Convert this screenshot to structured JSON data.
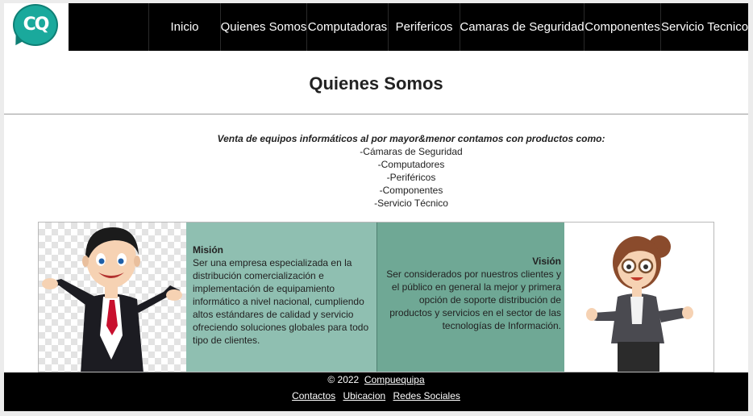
{
  "logo": {
    "text": "CQ"
  },
  "nav": {
    "items": [
      {
        "label": "Inicio"
      },
      {
        "label": "Quienes Somos"
      },
      {
        "label": "Computadoras"
      },
      {
        "label": "Perifericos"
      },
      {
        "label": "Camaras de Seguridad"
      },
      {
        "label": "Componentes"
      },
      {
        "label": "Servicio Tecnico"
      }
    ]
  },
  "page": {
    "title": "Quienes Somos"
  },
  "intro": {
    "lead": "Venta de equipos informáticos al por mayor&menor contamos con productos como:",
    "items": [
      "-Cámaras de Seguridad",
      "-Computadores",
      "-Periféricos",
      "-Componentes",
      "-Servicio Técnico"
    ]
  },
  "mision": {
    "heading": "Misión",
    "text": "Ser una empresa especializada en la distribución comercialización e implementación de equipamiento informático a nivel nacional, cumpliendo altos estándares de calidad y servicio ofreciendo soluciones globales para todo tipo de clientes."
  },
  "vision": {
    "heading": "Visión",
    "text": "Ser considerados por nuestros clientes y el público en general la mejor y primera opción de soporte distribución de productos y servicios en el sector de las tecnologías de Información."
  },
  "footer": {
    "copyright": "© 2022",
    "brand": "Compuequipa",
    "links": [
      {
        "label": "Contactos"
      },
      {
        "label": "Ubicacion"
      },
      {
        "label": "Redes Sociales"
      }
    ]
  },
  "colors": {
    "mision_bg": "#8fbfb1",
    "vision_bg": "#6fa895",
    "logo": "#1aa99c",
    "nav_bg": "#000000"
  }
}
